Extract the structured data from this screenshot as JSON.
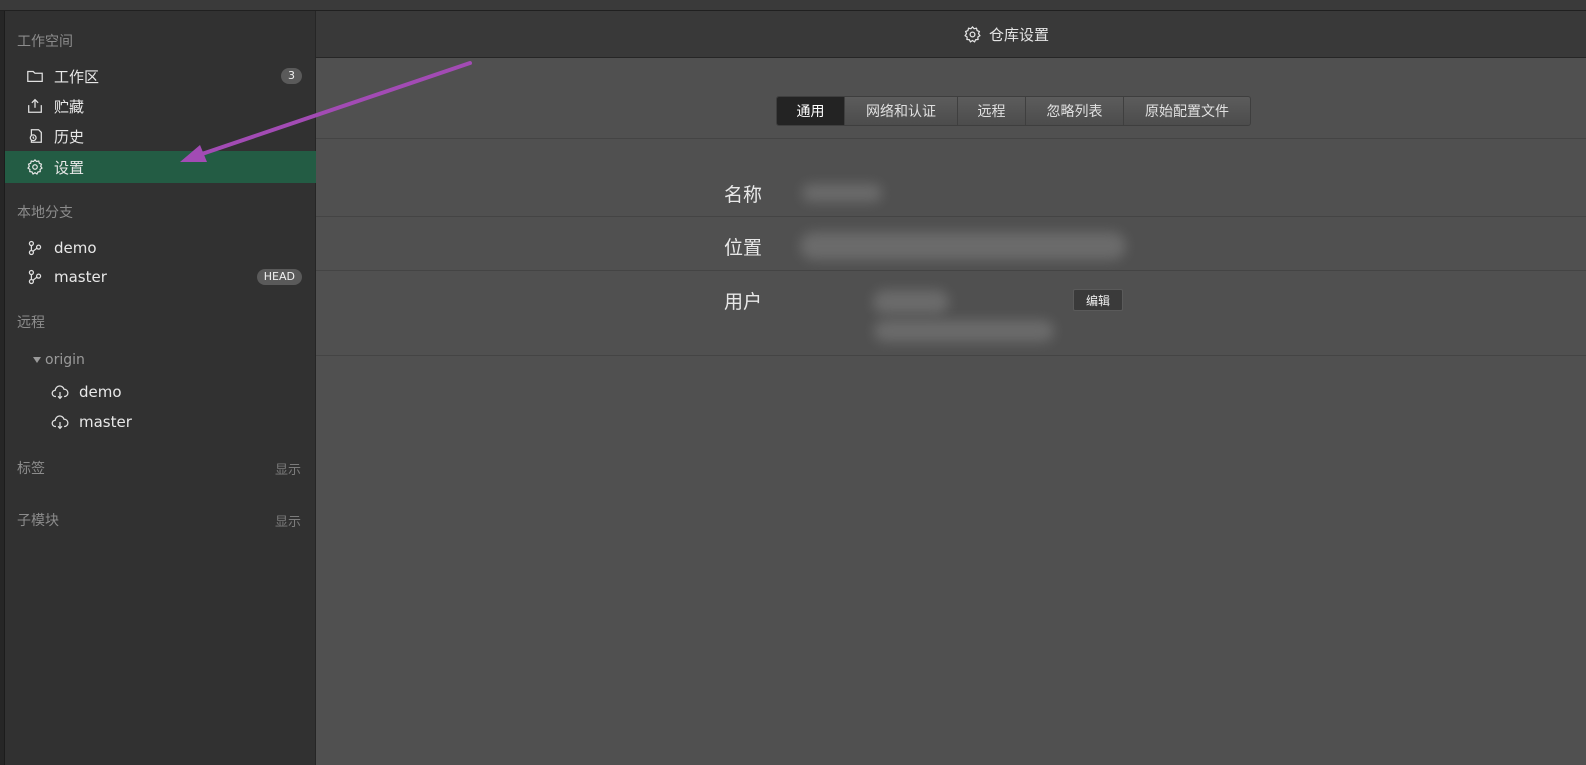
{
  "sidebar": {
    "workspace": {
      "title": "工作空间",
      "items": [
        {
          "label": "工作区",
          "icon": "folder-icon",
          "badge": "3"
        },
        {
          "label": "贮藏",
          "icon": "stash-icon"
        },
        {
          "label": "历史",
          "icon": "history-icon"
        },
        {
          "label": "设置",
          "icon": "gear-icon",
          "selected": true
        }
      ]
    },
    "local_branches": {
      "title": "本地分支",
      "items": [
        {
          "label": "demo",
          "icon": "branch-icon"
        },
        {
          "label": "master",
          "icon": "branch-icon",
          "badge": "HEAD"
        }
      ]
    },
    "remotes": {
      "title": "远程",
      "origin": "origin",
      "items": [
        {
          "label": "demo",
          "icon": "cloud-icon"
        },
        {
          "label": "master",
          "icon": "cloud-icon"
        }
      ]
    },
    "tags": {
      "title": "标签",
      "action": "显示"
    },
    "submodules": {
      "title": "子模块",
      "action": "显示"
    }
  },
  "header": {
    "title": "仓库设置",
    "icon": "gear-icon"
  },
  "tabs": [
    {
      "label": "通用",
      "active": true
    },
    {
      "label": "网络和认证"
    },
    {
      "label": "远程"
    },
    {
      "label": "忽略列表"
    },
    {
      "label": "原始配置文件"
    }
  ],
  "settings": {
    "name_label": "名称",
    "location_label": "位置",
    "user_label": "用户",
    "edit_button": "编辑"
  },
  "colors": {
    "selected_bg": "#235c44",
    "annotation_arrow": "#a24bb4",
    "panel_bg": "#505050",
    "sidebar_bg": "#313131"
  }
}
